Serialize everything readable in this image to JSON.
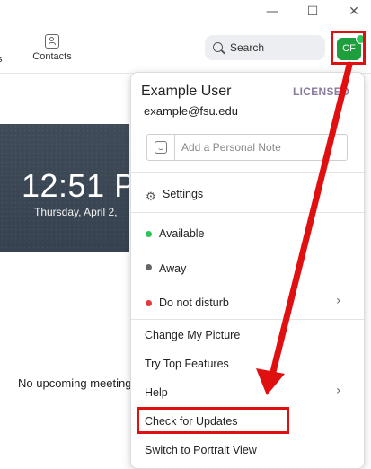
{
  "window": {
    "minimize": "—",
    "maximize": "☐",
    "close": "✕"
  },
  "nav": {
    "partial_label": "s",
    "contacts_label": "Contacts"
  },
  "search": {
    "label": "Search"
  },
  "avatar": {
    "initials": "CF"
  },
  "home": {
    "clock": "12:51 P",
    "date": "Thursday, April 2, ",
    "no_meetings": "No upcoming meeting"
  },
  "menu": {
    "user_name": "Example User",
    "license": "LICENSED",
    "email": "example@fsu.edu",
    "note_placeholder": "Add a Personal Note",
    "settings": "Settings",
    "status": [
      {
        "label": "Available",
        "color": "#2ec45a"
      },
      {
        "label": "Away",
        "color": "#666666"
      },
      {
        "label": "Do not disturb",
        "color": "#e0393e"
      }
    ],
    "change_picture": "Change My Picture",
    "top_features": "Try Top Features",
    "help": "Help",
    "check_updates": "Check for Updates",
    "portrait_view": "Switch to Portrait View"
  },
  "annotation_color": "#e01010"
}
